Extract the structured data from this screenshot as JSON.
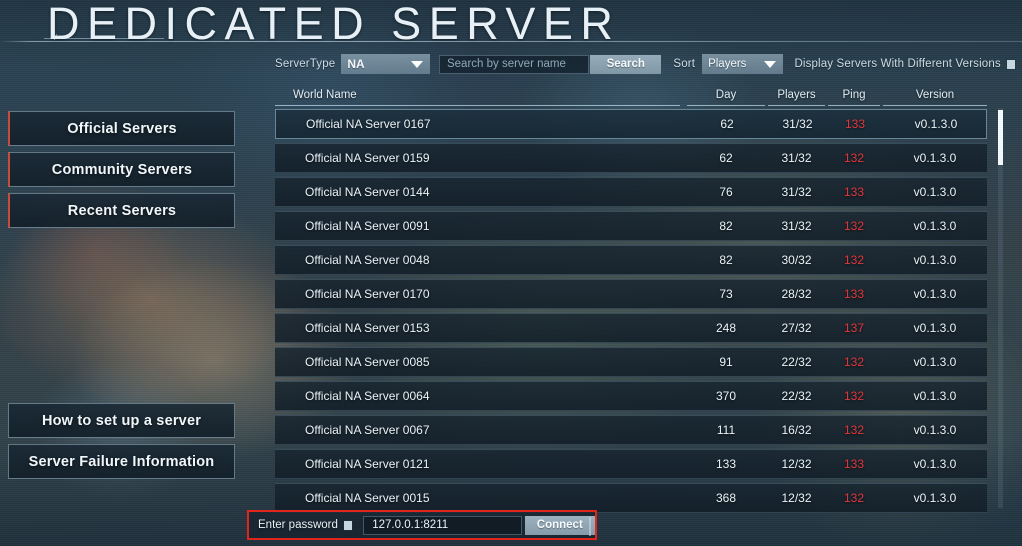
{
  "window": {
    "title": "DEDICATED SERVER"
  },
  "toolbar": {
    "server_type_label": "ServerType",
    "server_type_value": "NA",
    "search_placeholder": "Search by server name",
    "search_value": "",
    "search_button": "Search",
    "sort_label": "Sort",
    "sort_value": "Players",
    "different_versions_label": "Display Servers With Different Versions",
    "different_versions_checked": false,
    "dropdown_icon": "chevron-down-icon",
    "checkbox_icon": "checkbox-icon"
  },
  "sidebar": {
    "primary": [
      {
        "label": "Official Servers",
        "active": true
      },
      {
        "label": "Community Servers",
        "active": true
      },
      {
        "label": "Recent Servers",
        "active": true
      }
    ],
    "secondary": [
      {
        "label": "How to set up a server",
        "active": false
      },
      {
        "label": "Server Failure Information",
        "active": false
      }
    ]
  },
  "table": {
    "columns": [
      {
        "key": "name",
        "label": "World Name"
      },
      {
        "key": "day",
        "label": "Day"
      },
      {
        "key": "players",
        "label": "Players"
      },
      {
        "key": "ping",
        "label": "Ping"
      },
      {
        "key": "version",
        "label": "Version"
      }
    ],
    "rows": [
      {
        "name": "Official NA Server 0167",
        "day": "62",
        "players": "31/32",
        "ping": "133",
        "version": "v0.1.3.0",
        "selected": true
      },
      {
        "name": "Official NA Server 0159",
        "day": "62",
        "players": "31/32",
        "ping": "132",
        "version": "v0.1.3.0",
        "selected": false
      },
      {
        "name": "Official NA Server 0144",
        "day": "76",
        "players": "31/32",
        "ping": "133",
        "version": "v0.1.3.0",
        "selected": false
      },
      {
        "name": "Official NA Server 0091",
        "day": "82",
        "players": "31/32",
        "ping": "132",
        "version": "v0.1.3.0",
        "selected": false
      },
      {
        "name": "Official NA Server 0048",
        "day": "82",
        "players": "30/32",
        "ping": "132",
        "version": "v0.1.3.0",
        "selected": false
      },
      {
        "name": "Official NA Server 0170",
        "day": "73",
        "players": "28/32",
        "ping": "133",
        "version": "v0.1.3.0",
        "selected": false
      },
      {
        "name": "Official NA Server 0153",
        "day": "248",
        "players": "27/32",
        "ping": "137",
        "version": "v0.1.3.0",
        "selected": false
      },
      {
        "name": "Official NA Server 0085",
        "day": "91",
        "players": "22/32",
        "ping": "132",
        "version": "v0.1.3.0",
        "selected": false
      },
      {
        "name": "Official NA Server 0064",
        "day": "370",
        "players": "22/32",
        "ping": "132",
        "version": "v0.1.3.0",
        "selected": false
      },
      {
        "name": "Official NA Server 0067",
        "day": "111",
        "players": "16/32",
        "ping": "132",
        "version": "v0.1.3.0",
        "selected": false
      },
      {
        "name": "Official NA Server 0121",
        "day": "133",
        "players": "12/32",
        "ping": "133",
        "version": "v0.1.3.0",
        "selected": false
      },
      {
        "name": "Official NA Server 0015",
        "day": "368",
        "players": "12/32",
        "ping": "132",
        "version": "v0.1.3.0",
        "selected": false
      }
    ]
  },
  "connect_bar": {
    "password_label": "Enter password",
    "password_checked": false,
    "address_value": "127.0.0.1:8211",
    "connect_button": "Connect",
    "highlight_color": "#e0251d"
  },
  "colors": {
    "ping_text": "#e2363a",
    "accent_red": "#c94b3a",
    "panel_text": "#eaf3f8",
    "scrollbar_thumb": "#f1f7fa"
  }
}
